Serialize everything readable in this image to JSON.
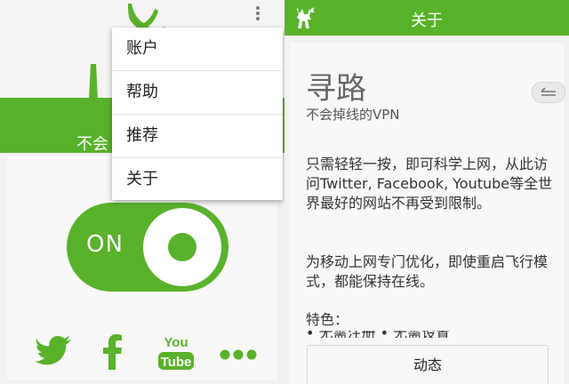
{
  "left_panel": {
    "slogan_partial": "不会",
    "menu": {
      "items": [
        {
          "label": "账户"
        },
        {
          "label": "帮助"
        },
        {
          "label": "推荐"
        },
        {
          "label": "关于"
        }
      ]
    },
    "toggle": {
      "label": "ON",
      "state": "on"
    },
    "social": [
      {
        "icon": "twitter-icon"
      },
      {
        "icon": "facebook-icon"
      },
      {
        "icon": "youtube-icon",
        "text_top": "You",
        "text_bottom": "Tube"
      },
      {
        "icon": "more-icon"
      }
    ]
  },
  "right_panel": {
    "header_title": "关于",
    "app_name": "寻路",
    "tagline": "不会掉线的VPN",
    "description_1": "只需轻轻一按，即可科学上网，从此访问Twitter, Facebook, Youtube等全世界最好的网站不再受到限制。",
    "description_2": "为移动上网专门优化，即使重启飞行模式，都能保持在线。",
    "features_label": "特色：",
    "features_cut_text": "• 无需注册 • 无需设置",
    "news_button": "动态"
  },
  "colors": {
    "brand_green": "#58b22a",
    "background": "#f1f1f1"
  }
}
